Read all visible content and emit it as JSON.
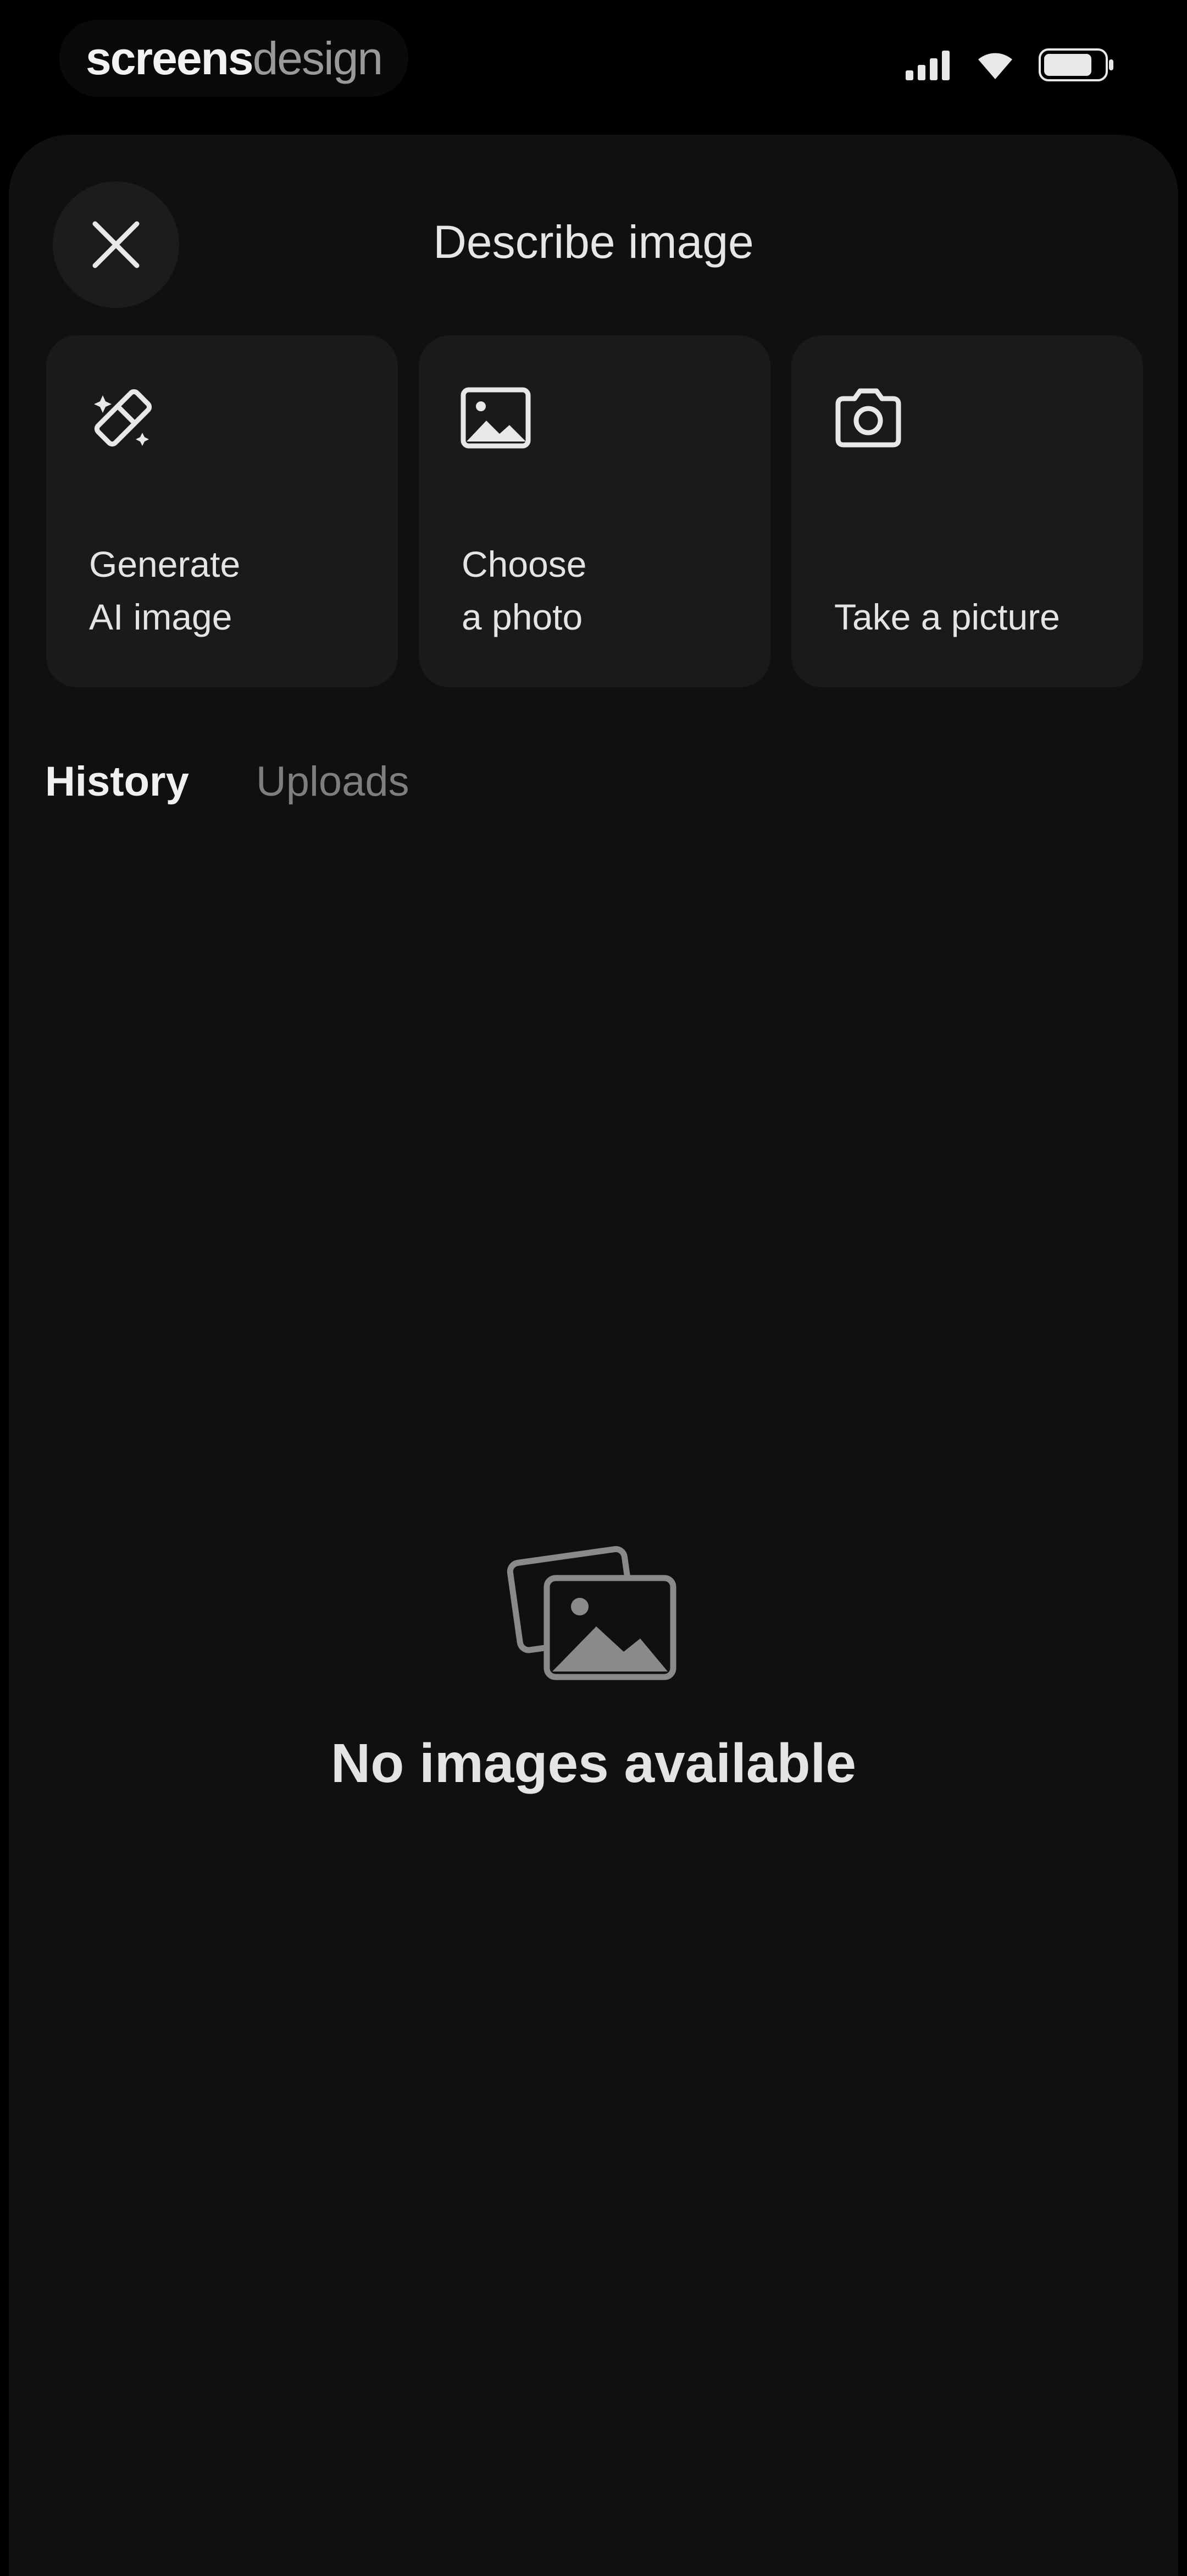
{
  "status_bar": {
    "brand_bold": "screens",
    "brand_light": "design",
    "icons": [
      "signal-icon",
      "wifi-icon",
      "battery-icon"
    ]
  },
  "header": {
    "title": "Describe image",
    "close_icon": "close-icon"
  },
  "actions": [
    {
      "icon": "sparkle-icon",
      "label": "Generate\nAI image"
    },
    {
      "icon": "image-icon",
      "label": "Choose\na photo"
    },
    {
      "icon": "camera-icon",
      "label": "Take a picture"
    }
  ],
  "tabs": [
    {
      "label": "History",
      "active": true
    },
    {
      "label": "Uploads",
      "active": false
    }
  ],
  "empty_state": {
    "icon": "images-stack-icon",
    "message": "No images available"
  },
  "colors": {
    "background": "#000000",
    "sheet": "#101010",
    "card": "#1a1a1a",
    "text": "#e6e6e6",
    "muted": "#7e7e7e"
  }
}
